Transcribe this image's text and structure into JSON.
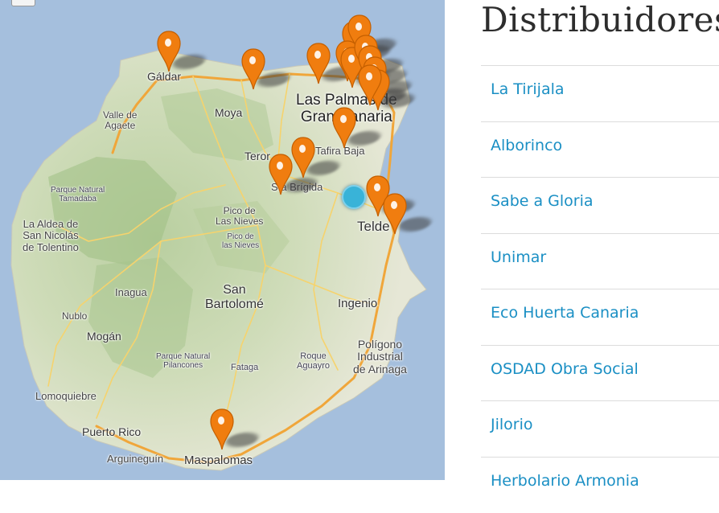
{
  "map": {
    "labels": {
      "galdar": "Gáldar",
      "valle_de_agaete": "Valle de\nAgaete",
      "moya": "Moya",
      "las_palmas": "Las Palmas de\nGran Canaria",
      "tafira_baja": "Tafira Baja",
      "teror": "Teror",
      "sta_brigida": "Sta Brígida",
      "parque_tamadaba": "Parque Natural\nTamadaba",
      "la_aldea": "La Aldea de\nSan Nicolás\nde Tolentino",
      "pico_nieves_1": "Pico de\nLas Nieves",
      "pico_nieves_2": "Pico de\nlas Nieves",
      "telde": "Telde",
      "inagua": "Inagua",
      "san_bartolome": "San\nBartolomé",
      "ingenio": "Ingenio",
      "nublo": "Nublo",
      "mogan": "Mogán",
      "parque_pilancones": "Parque Natural\nPilancones",
      "fataga": "Fataga",
      "roque_aguayro": "Roque\nAguayro",
      "poligono": "Polígono\nIndustrial\nde Arinaga",
      "lomoquiebre": "Lomoquiebre",
      "puerto_rico": "Puerto Rico",
      "arguineguin": "Arguineguín",
      "maspalomas": "Maspalomas"
    },
    "marker_icon": "map-pin-icon",
    "marker_color": "#f07d0f",
    "location_color": "#39b3d8"
  },
  "sidebar": {
    "title": "Distribuidores",
    "items": [
      {
        "label": "La Tirijala"
      },
      {
        "label": "Alborinco"
      },
      {
        "label": "Sabe a Gloria"
      },
      {
        "label": "Unimar"
      },
      {
        "label": "Eco Huerta Canaria"
      },
      {
        "label": "OSDAD Obra Social"
      },
      {
        "label": "Jilorio"
      },
      {
        "label": "Herbolario Armonia"
      }
    ]
  }
}
